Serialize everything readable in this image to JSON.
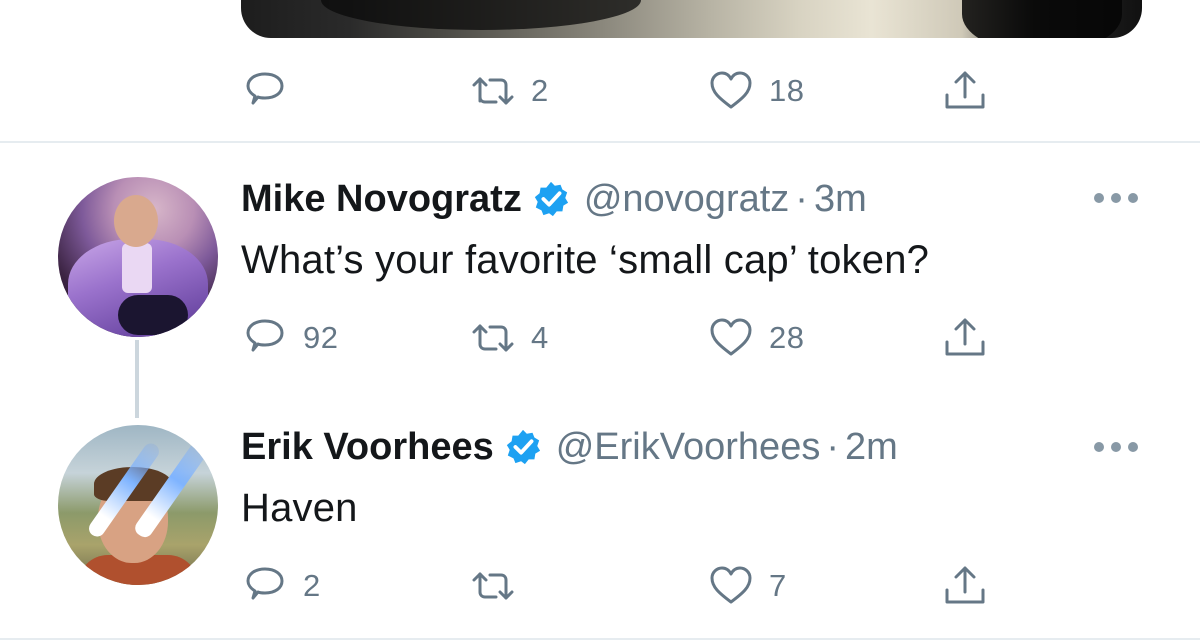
{
  "top_tweet": {
    "actions": {
      "reply_count": "",
      "retweet_count": "2",
      "like_count": "18"
    }
  },
  "tweets": [
    {
      "display_name": "Mike Novogratz",
      "handle": "@novogratz",
      "separator": "·",
      "time": "3m",
      "text": "What’s your favorite ‘small cap’ token?",
      "reply_count": "92",
      "retweet_count": "4",
      "like_count": "28"
    },
    {
      "display_name": "Erik Voorhees",
      "handle": "@ErikVoorhees",
      "separator": "·",
      "time": "2m",
      "text": "Haven",
      "reply_count": "2",
      "retweet_count": "",
      "like_count": "7"
    }
  ],
  "colors": {
    "text_primary": "#14171a",
    "text_secondary": "#657786",
    "verified_blue": "#1da1f2",
    "divider": "#e6ecf0",
    "thread_line": "#ccd6dd"
  },
  "icons": {
    "reply": "reply-icon",
    "retweet": "retweet-icon",
    "like": "heart-icon",
    "share": "share-icon",
    "verified": "verified-badge-icon",
    "more": "more-icon"
  }
}
